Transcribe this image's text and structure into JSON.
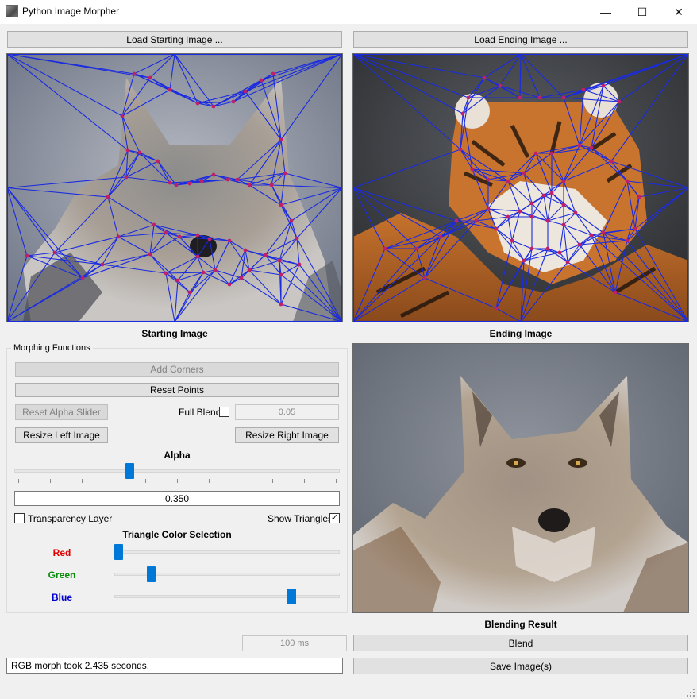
{
  "window": {
    "title": "Python Image Morpher",
    "minimize_glyph": "—",
    "maximize_glyph": "☐",
    "close_glyph": "✕"
  },
  "top_buttons": {
    "load_start": "Load Starting Image ...",
    "load_end": "Load Ending Image ..."
  },
  "captions": {
    "start": "Starting Image",
    "end": "Ending Image",
    "result": "Blending Result"
  },
  "morph": {
    "group_title": "Morphing Functions",
    "add_corners": "Add Corners",
    "reset_points": "Reset Points",
    "reset_alpha": "Reset Alpha Slider",
    "full_blend_label": "Full Blend",
    "full_blend_checked": false,
    "full_blend_value": "0.05",
    "resize_left": "Resize Left Image",
    "resize_right": "Resize Right Image",
    "alpha_label": "Alpha",
    "alpha_value": "0.350",
    "alpha_fraction": 0.35,
    "alpha_ticks": 11,
    "transparency_label": "Transparency Layer",
    "transparency_checked": false,
    "show_triangles_label": "Show Triangles",
    "show_triangles_checked": true,
    "triangle_color_title": "Triangle Color Selection",
    "red_label": "Red",
    "green_label": "Green",
    "blue_label": "Blue",
    "red_fraction": 0.0,
    "green_fraction": 0.15,
    "blue_fraction": 0.8,
    "red_color": "#e00000",
    "green_color": "#0a8a0a",
    "blue_color": "#0000cc"
  },
  "bottom": {
    "frame_time": "100 ms",
    "blend": "Blend",
    "save": "Save Image(s)",
    "status": "RGB morph took 2.435 seconds."
  },
  "colors": {
    "triangle_line": "#1a2be0",
    "point": "#c0206a",
    "accent": "#0078d7"
  }
}
